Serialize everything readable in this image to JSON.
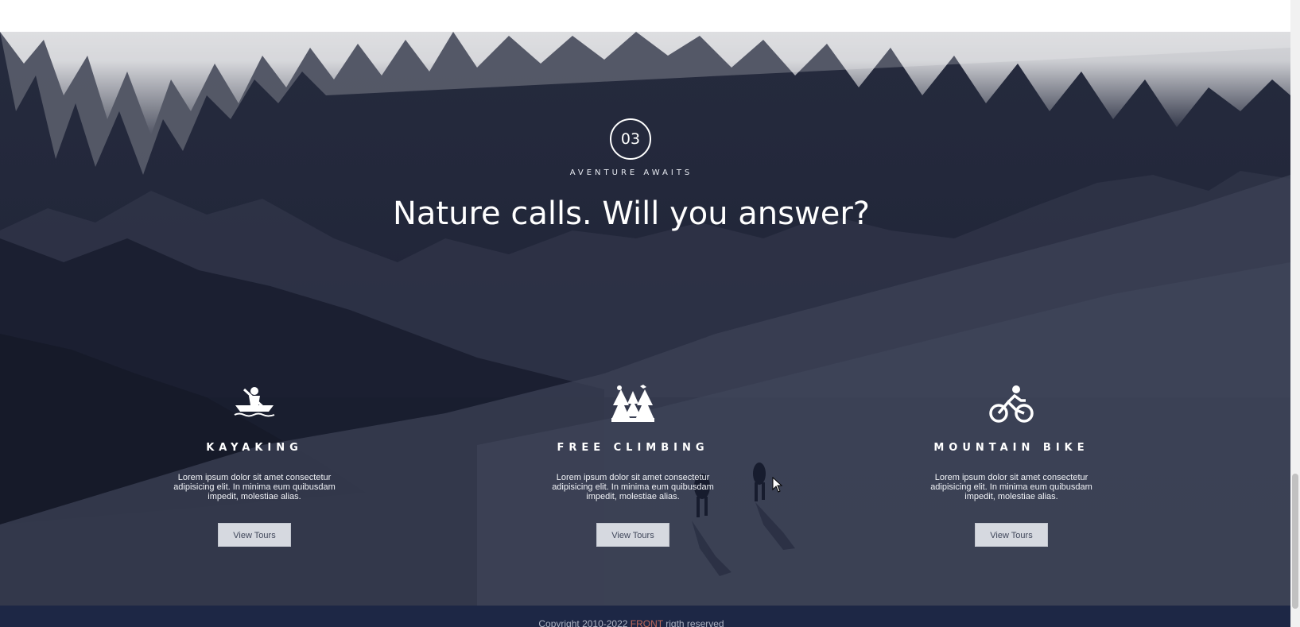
{
  "section": {
    "number": "03",
    "eyebrow": "AVENTURE AWAITS",
    "headline": "Nature calls. Will you answer?"
  },
  "features": [
    {
      "icon": "kayak-icon",
      "title": "KAYAKING",
      "description": "Lorem ipsum dolor sit amet consectetur adipisicing elit. In minima eum quibusdam impedit, molestiae alias.",
      "button_label": "View Tours"
    },
    {
      "icon": "trees-icon",
      "title": "FREE CLIMBING",
      "description": "Lorem ipsum dolor sit amet consectetur adipisicing elit. In minima eum quibusdam impedit, molestiae alias.",
      "button_label": "View Tours"
    },
    {
      "icon": "bicycle-icon",
      "title": "MOUNTAIN BIKE",
      "description": "Lorem ipsum dolor sit amet consectetur adipisicing elit. In minima eum quibusdam impedit, molestiae alias.",
      "button_label": "View Tours"
    }
  ],
  "footer": {
    "prefix": "Copyright 2010-2022 ",
    "brand": "FRONT",
    "suffix": " rigth reserved"
  },
  "colors": {
    "overlay": "#22273a",
    "footer_bg": "#1d2745",
    "button_bg": "#d6d9e0",
    "brand_accent": "#c06a5a"
  }
}
